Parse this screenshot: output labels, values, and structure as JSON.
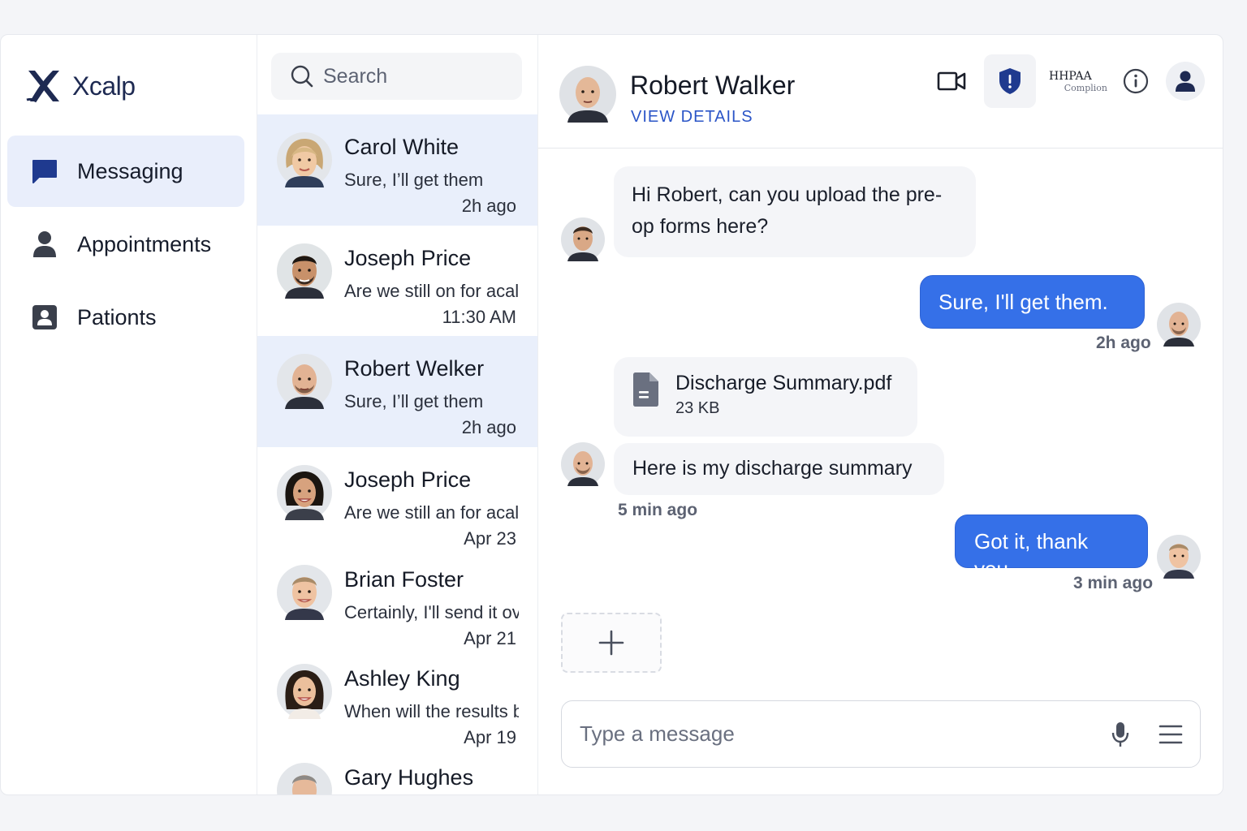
{
  "brand": {
    "name": "Xcalp",
    "logo_icon": "x-logo-icon",
    "accent": "#1e2a52"
  },
  "nav": {
    "items": [
      {
        "label": "Messaging",
        "icon": "chat-bubble-icon",
        "active": true
      },
      {
        "label": "Appointments",
        "icon": "person-icon",
        "active": false
      },
      {
        "label": "Pationts",
        "icon": "contact-card-icon",
        "active": false
      }
    ]
  },
  "search": {
    "placeholder": "Search"
  },
  "conversations": [
    {
      "name": "Carol White",
      "preview": "Sure, I’ll get them",
      "time": "2h ago",
      "active": true
    },
    {
      "name": "Joseph Price",
      "preview": "Are we still on for acall",
      "time": "11:30 AM",
      "active": false
    },
    {
      "name": "Robert Welker",
      "preview": "Sure, I’ll get them",
      "time": "2h ago",
      "active": true
    },
    {
      "name": "Joseph Price",
      "preview": "Are we still an for acall",
      "time": "Apr 23",
      "active": false
    },
    {
      "name": "Brian Foster",
      "preview": "Certainly, I'll send it over",
      "time": "Apr 21",
      "active": false
    },
    {
      "name": "Ashley King",
      "preview": "When will the results be",
      "time": "Apr 19",
      "active": false
    },
    {
      "name": "Gary Hughes",
      "preview": "",
      "time": "",
      "active": false
    }
  ],
  "chat": {
    "contact_name": "Robert Walker",
    "view_details": "VIEW DETAILS",
    "compliance": {
      "line1": "HHPAA",
      "line2": "Complion"
    },
    "header_icons": [
      "video-camera-icon",
      "shield-alert-icon",
      "info-icon",
      "profile-icon"
    ],
    "messages": {
      "m1": {
        "text": "Hi Robert, can you upload the pre-op forms here?",
        "direction": "in"
      },
      "m2": {
        "text": "Sure, I'll get them.",
        "direction": "out",
        "time": "2h ago"
      },
      "m3": {
        "file_name": "Discharge Summary.pdf",
        "file_size": "23 KB",
        "direction": "in"
      },
      "m4": {
        "text": "Here is my discharge summary",
        "direction": "in",
        "time": "5 min ago"
      },
      "m5": {
        "text": "Got it, thank you.",
        "direction": "out",
        "time": "3 min ago"
      }
    },
    "composer": {
      "placeholder": "Type a message"
    },
    "outgoing_color": "#3570e8"
  }
}
